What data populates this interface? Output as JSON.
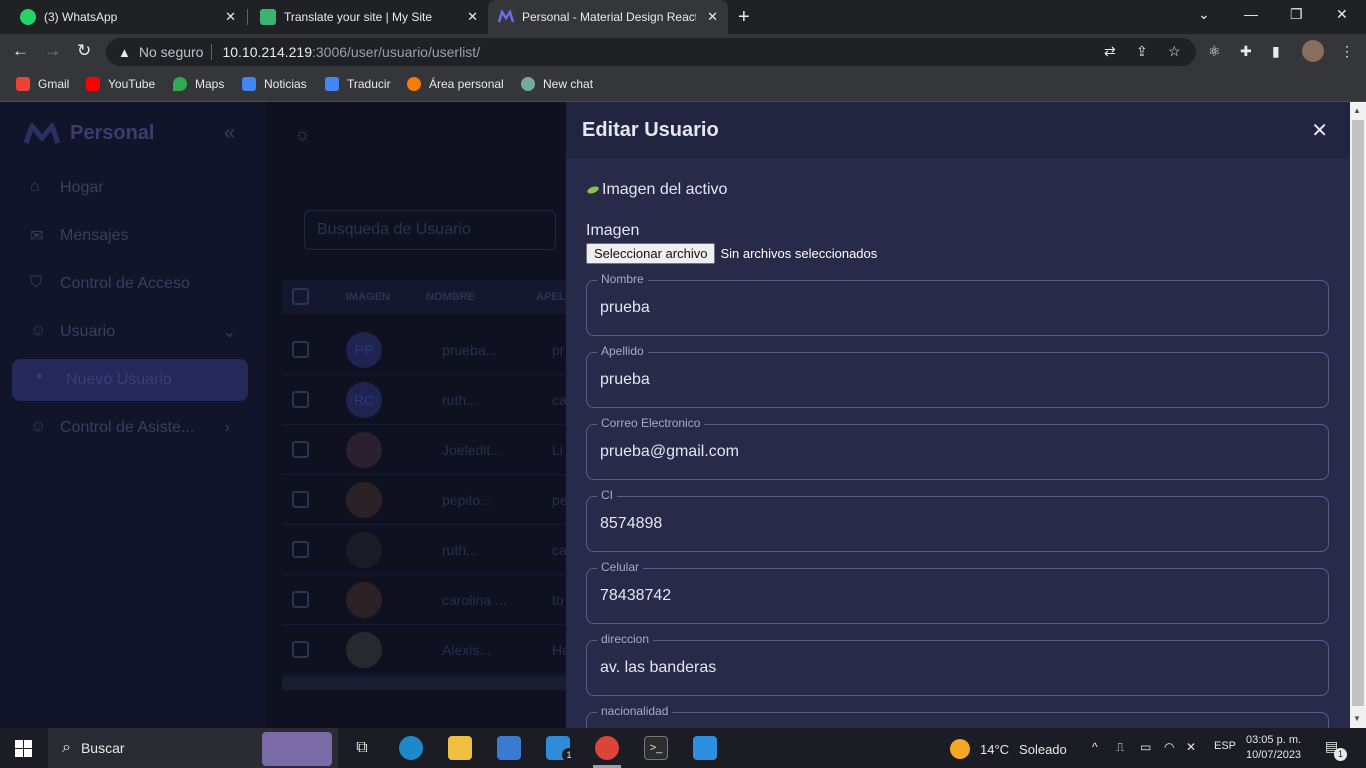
{
  "browser": {
    "tabs": [
      {
        "label": "(3) WhatsApp",
        "icon": "whatsapp-icon",
        "color": "#25d366"
      },
      {
        "label": "Translate your site | My Site",
        "icon": "site-icon",
        "color": "#3cb371"
      },
      {
        "label": "Personal - Material Design React",
        "icon": "material-logo-icon",
        "color": "#6c6cf0"
      }
    ],
    "address": {
      "security": "No seguro",
      "host": "10.10.214.219",
      "path": ":3006/user/usuario/userlist/"
    },
    "bookmarks": [
      {
        "label": "Gmail",
        "color": "#ea4335"
      },
      {
        "label": "YouTube",
        "color": "#ff0000"
      },
      {
        "label": "Maps",
        "color": "#34a853"
      },
      {
        "label": "Noticias",
        "color": "#4285f4"
      },
      {
        "label": "Traducir",
        "color": "#4285f4"
      },
      {
        "label": "Área personal",
        "color": "#f57c00"
      },
      {
        "label": "New chat",
        "color": "#74aa9c"
      }
    ]
  },
  "sidebar": {
    "brand": "Personal",
    "items": [
      {
        "label": "Hogar",
        "icon": "home-icon"
      },
      {
        "label": "Mensajes",
        "icon": "mail-icon"
      },
      {
        "label": "Control de Acceso",
        "icon": "shield-icon"
      },
      {
        "label": "Usuario",
        "icon": "user-icon"
      },
      {
        "label": "Nuevo Usuario",
        "icon": "user-add-icon"
      },
      {
        "label": "Control de Asiste...",
        "icon": "user-icon"
      }
    ]
  },
  "list": {
    "search_placeholder": "Busqueda de Usuario",
    "columns": [
      "IMAGEN",
      "NOMBRE",
      "APELL"
    ],
    "rows": [
      {
        "initials": "PP",
        "name": "prueba...",
        "last": "pr"
      },
      {
        "initials": "RC",
        "name": "ruth...",
        "last": "ca"
      },
      {
        "initials": "",
        "name": "Joeledit...",
        "last": "Li"
      },
      {
        "initials": "",
        "name": "pepito...",
        "last": "pe"
      },
      {
        "initials": "",
        "name": "ruth...",
        "last": "ca"
      },
      {
        "initials": "",
        "name": "carolina ...",
        "last": "to"
      },
      {
        "initials": "",
        "name": "Alexis...",
        "last": "Ha"
      }
    ]
  },
  "drawer": {
    "title": "Editar Usuario",
    "image_alt": "Imagen del activo",
    "image_label": "Imagen",
    "file_button": "Seleccionar archivo",
    "file_status": "Sin archivos seleccionados",
    "fields": [
      {
        "label": "Nombre",
        "value": "prueba"
      },
      {
        "label": "Apellido",
        "value": "prueba"
      },
      {
        "label": "Correo Electronico",
        "value": "prueba@gmail.com"
      },
      {
        "label": "CI",
        "value": "8574898"
      },
      {
        "label": "Celular",
        "value": "78438742"
      },
      {
        "label": "direccion",
        "value": "av. las banderas"
      },
      {
        "label": "nacionalidad",
        "value": ""
      }
    ]
  },
  "taskbar": {
    "search": "Buscar",
    "weather": {
      "temp": "14°C",
      "desc": "Soleado"
    },
    "lang": "ESP",
    "time": "03:05 p. m.",
    "date": "10/07/2023",
    "notifications": "1",
    "mail_badge": "1"
  }
}
